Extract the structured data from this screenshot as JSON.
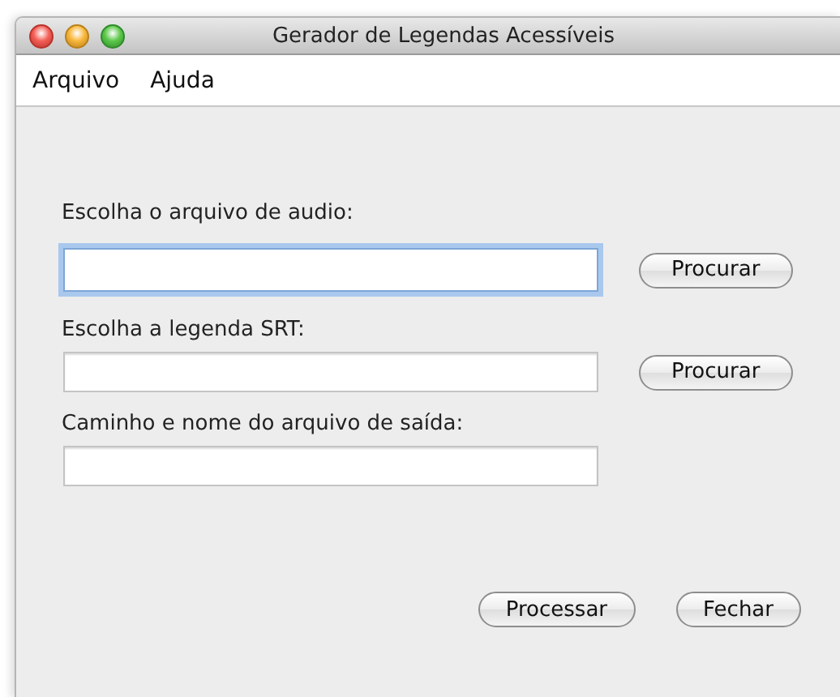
{
  "window": {
    "title": "Gerador de Legendas Acessíveis"
  },
  "menu": [
    "Arquivo",
    "Ajuda"
  ],
  "fields": [
    {
      "label": "Escolha o arquivo de audio:",
      "focused": true,
      "button": "Procurar"
    },
    {
      "label": "Escolha a legenda SRT:",
      "focused": false,
      "button": "Procurar"
    },
    {
      "label": "Caminho e nome do arquivo de saída:",
      "focused": false
    }
  ],
  "buttons": [
    "Processar",
    "Fechar"
  ]
}
